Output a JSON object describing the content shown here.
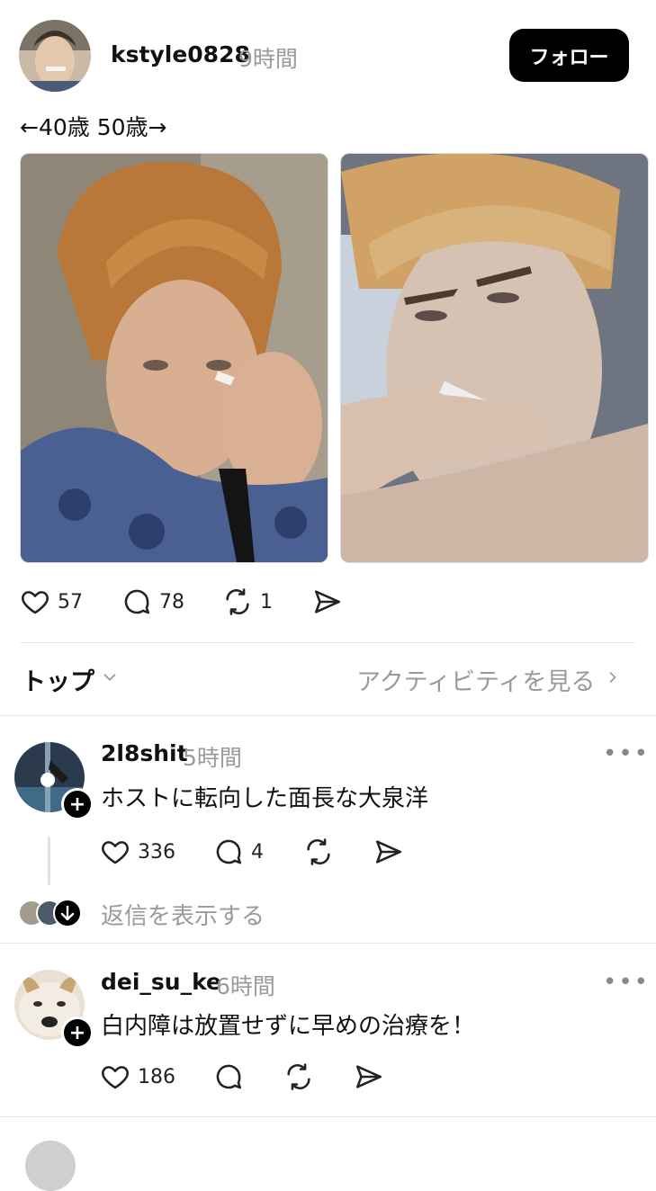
{
  "post": {
    "username": "kstyle0828",
    "time": "9時間",
    "follow_label": "フォロー",
    "caption": "←40歳 50歳→",
    "likes": "57",
    "comments": "78",
    "reposts": "1"
  },
  "sort": {
    "label": "トップ",
    "activity_link": "アクティビティを見る"
  },
  "replies": [
    {
      "username": "2l8shit",
      "time": "5時間",
      "text": "ホストに転向した面長な大泉洋",
      "likes": "336",
      "comments": "4",
      "show_replies": "返信を表示する"
    },
    {
      "username": "dei_su_ke",
      "time": "6時間",
      "text": "白内障は放置せずに早めの治療を！",
      "likes": "186"
    }
  ],
  "colors": {
    "accent": "#000000",
    "muted_text": "#9a9a9a",
    "divider": "#e6e6e6"
  }
}
